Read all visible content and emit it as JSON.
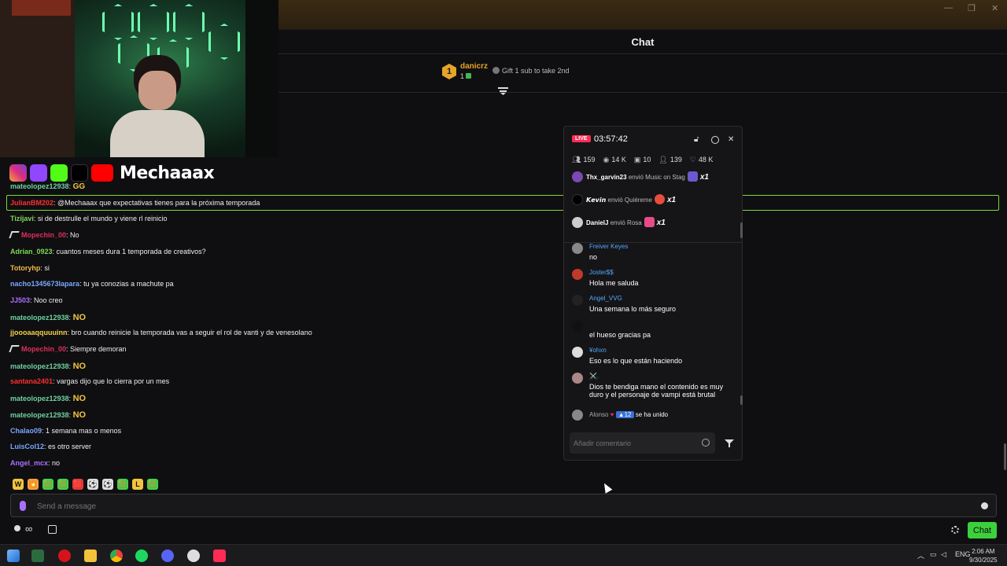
{
  "window": {
    "minimize": "—",
    "restore": "❐",
    "close": "✕"
  },
  "chat_header": {
    "title": "Chat"
  },
  "gift_bar": {
    "rank": "1",
    "user": "danicrz",
    "count": "1",
    "hint": "Gift 1 sub to take 2nd"
  },
  "stream": {
    "brand": "Mechaaax"
  },
  "chat": {
    "messages": [
      {
        "user": "mateolopez12938",
        "color": "#6fd0a0",
        "text": "",
        "emote": "GG",
        "badge": false
      },
      {
        "user": "JulianBM202",
        "color": "#ff2e2e",
        "text": "@Mechaaax que expectativas tienes para la próxima temporada",
        "emote": "",
        "badge": false
      },
      {
        "user": "Tizijavi",
        "color": "#7ed957",
        "text": "si de destrulle el mundo y viene rl reinicio",
        "emote": "",
        "badge": false
      },
      {
        "user": "Mopechin_00",
        "color": "#e02e5a",
        "text": "No",
        "emote": "",
        "badge": true
      },
      {
        "user": "Adrian_0923",
        "color": "#7ed957",
        "text": "cuantos meses dura 1 temporada de creativos?",
        "emote": "",
        "badge": false
      },
      {
        "user": "Totoryhp",
        "color": "#f2b84b",
        "text": "si",
        "emote": "",
        "badge": false
      },
      {
        "user": "nacho1345673lapara",
        "color": "#7aa7ff",
        "text": "tu ya conozias a machute pa",
        "emote": "",
        "badge": false
      },
      {
        "user": "JJ503",
        "color": "#a970ff",
        "text": "Noo creo",
        "emote": "",
        "badge": false
      },
      {
        "user": "mateolopez12938",
        "color": "#6fd0a0",
        "text": "",
        "emote": "NO",
        "badge": false
      },
      {
        "user": "jjoooaaqquuuinn",
        "color": "#f2d24b",
        "text": "bro cuando reinicie la temporada vas a seguir el rol de vanti y de venesolano",
        "emote": "",
        "badge": false
      },
      {
        "user": "Mopechin_00",
        "color": "#e02e5a",
        "text": "Siempre demoran",
        "emote": "",
        "badge": true
      },
      {
        "user": "mateolopez12938",
        "color": "#6fd0a0",
        "text": "",
        "emote": "NO",
        "badge": false
      },
      {
        "user": "santana2401",
        "color": "#ff2e2e",
        "text": "vargas dijo que lo cierra por un mes",
        "emote": "",
        "badge": false
      },
      {
        "user": "mateolopez12938",
        "color": "#6fd0a0",
        "text": "",
        "emote": "NO",
        "badge": false
      },
      {
        "user": "mateolopez12938",
        "color": "#6fd0a0",
        "text": "",
        "emote": "NO",
        "badge": false
      },
      {
        "user": "Chalao09",
        "color": "#7aa7ff",
        "text": "1 semana mas o menos",
        "emote": "",
        "badge": false
      },
      {
        "user": "LuisCol12",
        "color": "#7aa7ff",
        "text": "es otro server",
        "emote": "",
        "badge": false
      },
      {
        "user": "Angel_mcx",
        "color": "#a970ff",
        "text": "no",
        "emote": "",
        "badge": false
      }
    ],
    "emote_bar": [
      "W",
      "💥",
      "🟩",
      "🟩",
      "🟥",
      "⚽",
      "⚽",
      "🟩",
      "L",
      "🟩"
    ],
    "input_placeholder": "Send a message",
    "chat_button": "Chat",
    "infinity": "∞"
  },
  "tiktok": {
    "live": "LIVE",
    "timer": "03:57:42",
    "stats": {
      "viewers": "159",
      "views": "14 K",
      "gifts": "10",
      "followers": "139",
      "likes": "48 K"
    },
    "gifts": [
      {
        "user": "Thx_garvin23",
        "action": "envió Music on Stag",
        "mult": "x1"
      },
      {
        "user": "𝙆𝙚𝙫𝙞𝙣",
        "action": "envió Quiéreme",
        "mult": "x1"
      },
      {
        "user": "DanielJ",
        "action": "envió Rosa",
        "mult": "x1"
      }
    ],
    "messages": [
      {
        "user": "Freiver Keyes",
        "text": "no",
        "avatar": "#888"
      },
      {
        "user": "Joster$$",
        "text": "Hola me saluda",
        "avatar": "#c0392b"
      },
      {
        "user": "Angel_VVG",
        "text": "Una semana lo más seguro",
        "avatar": "#222"
      },
      {
        "user": "",
        "text": "el hueso gracias pa",
        "avatar": "#111"
      },
      {
        "user": "¥ohxn",
        "text": "Eso es lo que están haciendo",
        "avatar": "#ddd"
      },
      {
        "user": "⚔️.",
        "text": "Dios te bendiga mano el contenido es muy duro y el personaje de vampi está brutal",
        "avatar": "#a88"
      }
    ],
    "join": {
      "user": "Alonso",
      "level": "12",
      "text": "se ha unido"
    },
    "comment_placeholder": "Añadir comentario"
  },
  "taskbar": {
    "lang": "ENG",
    "time": "2:06 AM",
    "date": "9/30/2025"
  }
}
